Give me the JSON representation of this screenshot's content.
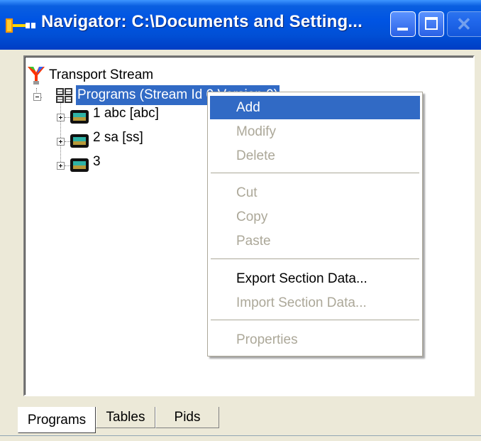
{
  "window": {
    "title": "Navigator: C:\\Documents and Setting...",
    "controls": {
      "minimize": "minimize-icon",
      "maximize": "maximize-icon",
      "close": "close-icon"
    }
  },
  "tree": {
    "root": {
      "label": "Transport Stream",
      "icon": "transport-stream-icon"
    },
    "programs_node": {
      "label": "Programs (Stream Id 0 Version 0)",
      "icon": "programs-grid-icon",
      "expanded": true,
      "selected": true
    },
    "programs": [
      {
        "label": "1 abc [abc]",
        "icon": "tv-icon",
        "expanded": false
      },
      {
        "label": "2 sa [ss]",
        "icon": "tv-icon",
        "expanded": false
      },
      {
        "label": "3",
        "icon": "tv-icon",
        "expanded": false
      }
    ]
  },
  "context_menu": {
    "items": [
      {
        "label": "Add",
        "enabled": true,
        "highlighted": true
      },
      {
        "label": "Modify",
        "enabled": false
      },
      {
        "label": "Delete",
        "enabled": false
      },
      {
        "label": "Cut",
        "enabled": false
      },
      {
        "label": "Copy",
        "enabled": false
      },
      {
        "label": "Paste",
        "enabled": false
      },
      {
        "label": "Export Section Data...",
        "enabled": true
      },
      {
        "label": "Import Section Data...",
        "enabled": false
      },
      {
        "label": "Properties",
        "enabled": false
      }
    ]
  },
  "tabs": [
    {
      "label": "Programs",
      "active": true
    },
    {
      "label": "Tables",
      "active": false
    },
    {
      "label": "Pids",
      "active": false
    }
  ],
  "colors": {
    "titlebar": "#0054e3",
    "selection": "#316ac5",
    "disabled_text": "#aca899",
    "window_bg": "#ece9d8"
  }
}
